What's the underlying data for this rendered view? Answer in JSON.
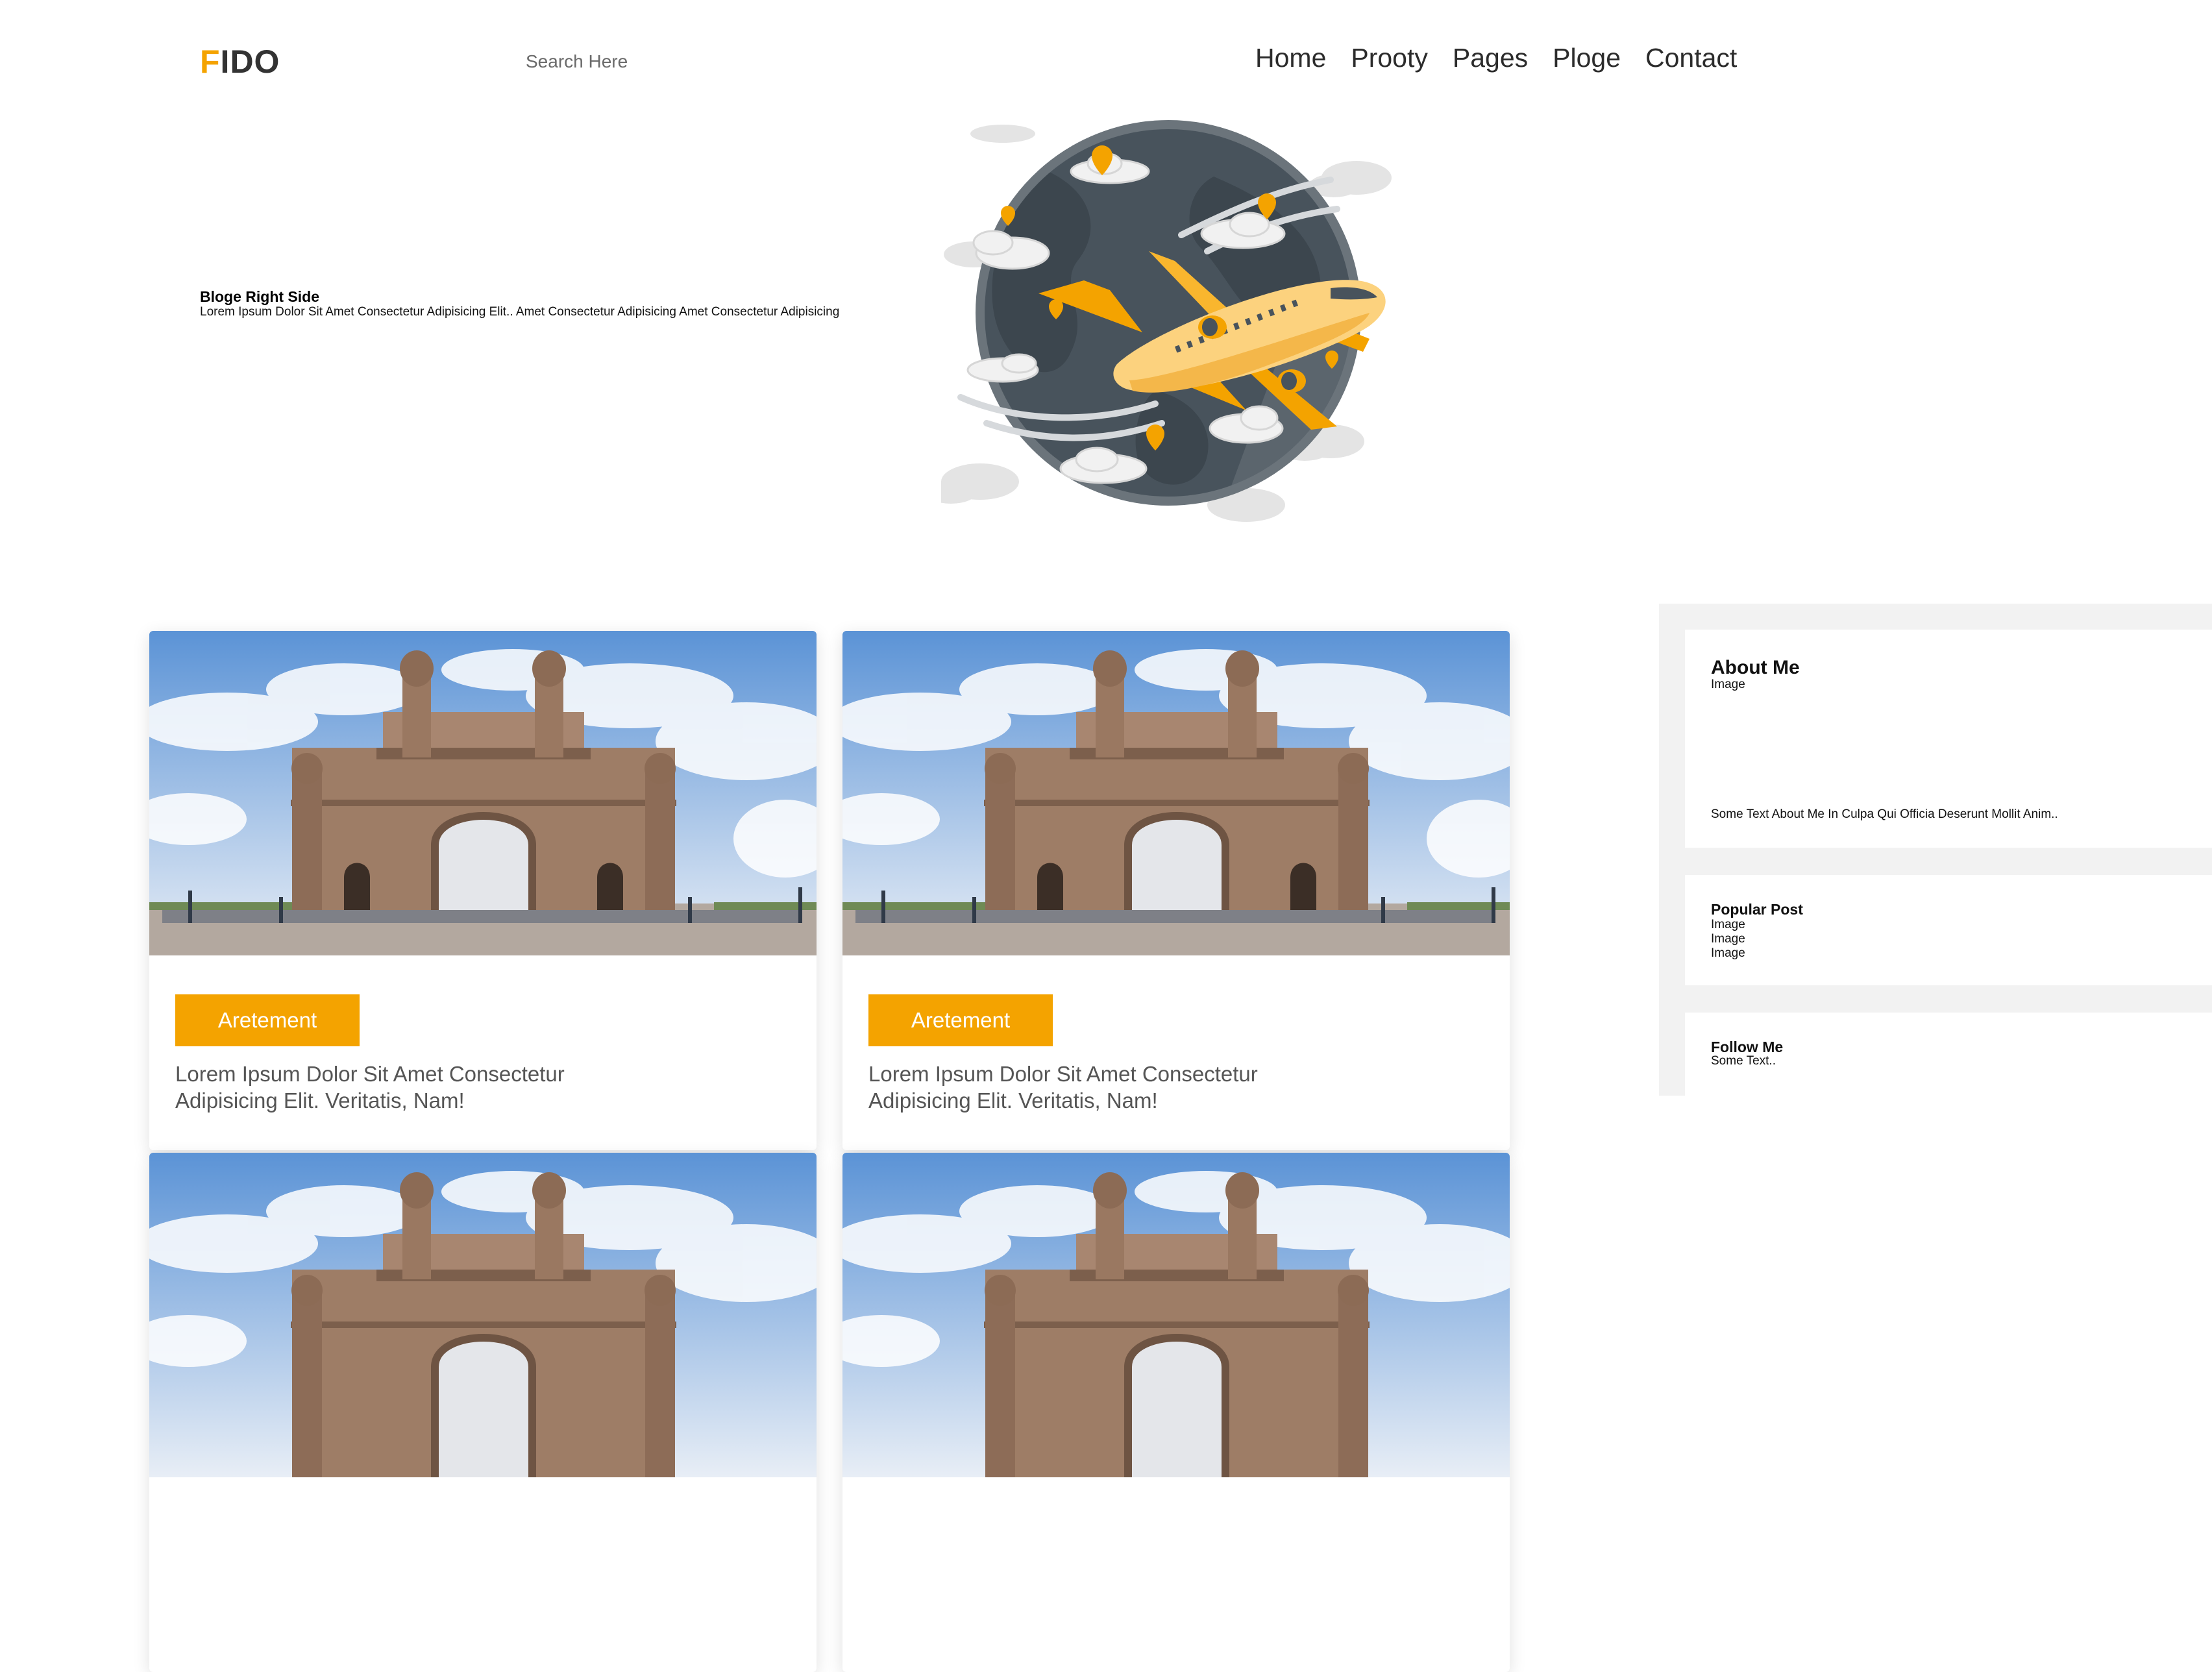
{
  "header": {
    "logo_first": "F",
    "logo_rest": "IDO",
    "search_placeholder": "Search Here",
    "nav": [
      "Home",
      "Prooty",
      "Pages",
      "Ploge",
      "Contact"
    ]
  },
  "hero": {
    "title": "Bloge Right Side",
    "subtitle": "Lorem Ipsum Dolor Sit Amet Consectetur Adipisicing Elit.. Amet Consectetur Adipisicing Amet Consectetur Adipisicing"
  },
  "cards": [
    {
      "badge": "Aretement",
      "text": "Lorem Ipsum Dolor Sit Amet Consectetur Adipisicing Elit. Veritatis, Nam!"
    },
    {
      "badge": "Aretement",
      "text": "Lorem Ipsum Dolor Sit Amet Consectetur Adipisicing Elit. Veritatis, Nam!"
    },
    {
      "badge": "",
      "text": ""
    },
    {
      "badge": "",
      "text": ""
    }
  ],
  "sidebar": {
    "about": {
      "title": "About Me",
      "image_label": "Image",
      "text": "Some Text About Me In Culpa Qui Officia Deserunt Mollit Anim.."
    },
    "popular": {
      "title": "Popular Post",
      "items": [
        "Image",
        "Image",
        "Image"
      ]
    },
    "follow": {
      "title": "Follow Me",
      "text": "Some Text.."
    }
  },
  "colors": {
    "accent": "#f4a300",
    "sidebar_bg": "#f2f2f2",
    "globe": "#48535c"
  },
  "icons": [
    "globe-icon",
    "airplane-icon",
    "map-pin-icon",
    "cloud-icon"
  ]
}
